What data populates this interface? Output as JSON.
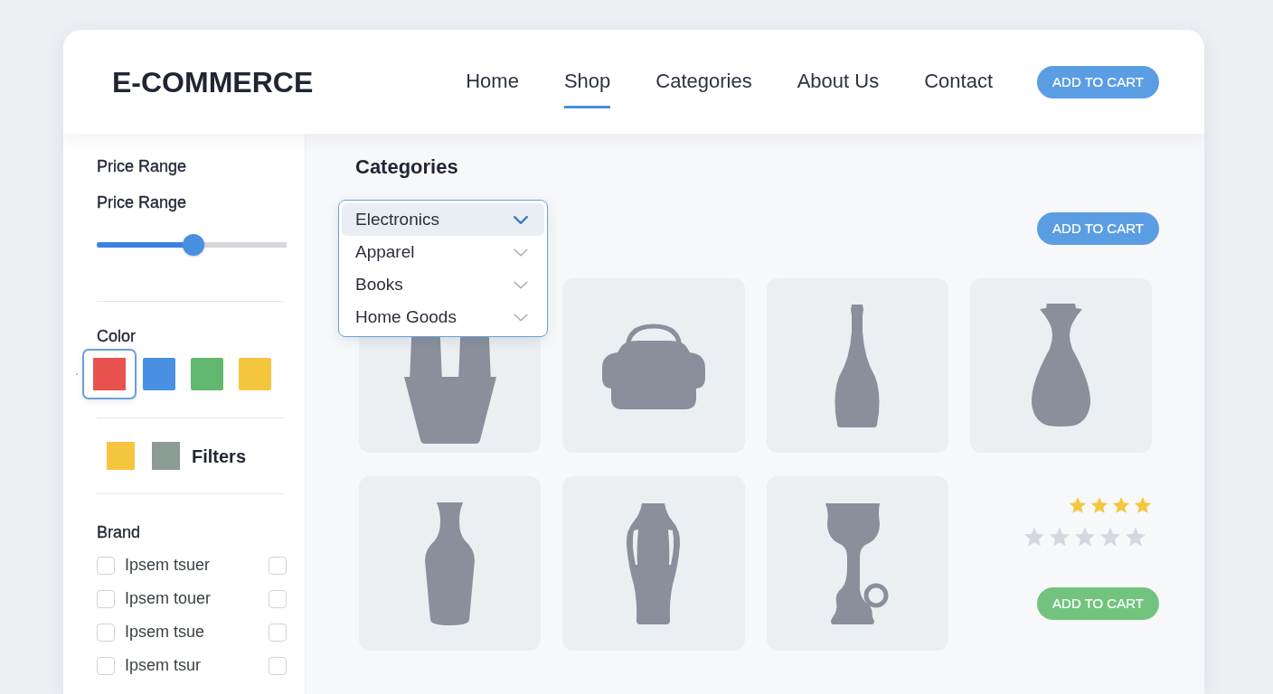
{
  "header": {
    "logo": "E-COMMERCE",
    "nav": [
      {
        "label": "Home",
        "selected": false
      },
      {
        "label": "Shop",
        "selected": true
      },
      {
        "label": "Categories",
        "selected": false
      },
      {
        "label": "About Us",
        "selected": false
      },
      {
        "label": "Contact",
        "selected": false
      }
    ],
    "button": "ADD TO CART"
  },
  "sidebar": {
    "price_range": {
      "title": "Price Range",
      "label": "Price Range",
      "level": 0.51
    },
    "color": {
      "title": "Color",
      "swatches": [
        {
          "color": "#e8524e",
          "selected": true
        },
        {
          "color": "#4a90e2",
          "selected": false
        },
        {
          "color": "#63b86f",
          "selected": false
        },
        {
          "color": "#f5c53d",
          "selected": false
        }
      ]
    },
    "filters": {
      "swatches": [
        {
          "color": "#f5c53d"
        },
        {
          "color": "#8a9c94"
        }
      ],
      "label": "Filters"
    },
    "brand": {
      "title": "Brand",
      "items": [
        {
          "label": "Ipsem tsuer",
          "checked": false,
          "second_checked": false
        },
        {
          "label": "Ipsem touer",
          "checked": false,
          "second_checked": false
        },
        {
          "label": "Ipsem tsue",
          "checked": false,
          "second_checked": false
        },
        {
          "label": "Ipsem tsur",
          "checked": false,
          "second_checked": false
        }
      ]
    }
  },
  "main": {
    "title": "Categories",
    "dropdown": {
      "expanded": true,
      "options": [
        {
          "label": "Electronics",
          "selected": true
        },
        {
          "label": "Apparel",
          "selected": false
        },
        {
          "label": "Books",
          "selected": false
        },
        {
          "label": "Home Goods",
          "selected": false
        }
      ]
    },
    "button": "ADD TO CART",
    "products": [
      {
        "kind": "bucket"
      },
      {
        "kind": "handbag"
      },
      {
        "kind": "bottle"
      },
      {
        "kind": "vase"
      },
      {
        "kind": "slim-vase"
      },
      {
        "kind": "amphora"
      },
      {
        "kind": "goblet"
      }
    ],
    "ratings": [
      {
        "kind": "compact",
        "stars": 4
      },
      {
        "kind": "full",
        "stars": 0
      }
    ],
    "cart_button": "ADD TO CART"
  }
}
